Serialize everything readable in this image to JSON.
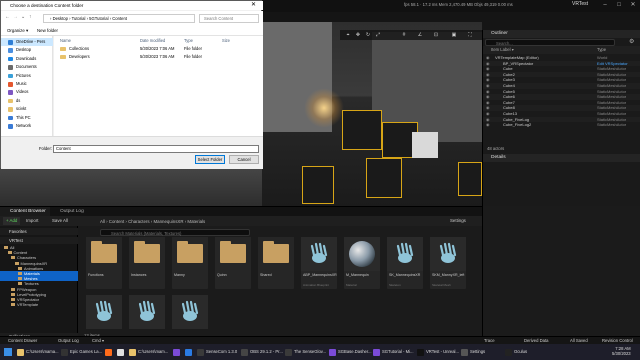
{
  "app": {
    "title": "VRTest"
  },
  "stats": "fps 58.1  · 17.2 ms  Mem 2,470.49 MB  Objs 49,319  0.00 ms",
  "dialog": {
    "title": "Choose a destination Content folder",
    "breadcrumb": [
      "Desktop",
      "Tutorial",
      "5GTutorial",
      "Content"
    ],
    "search_placeholder": "Search Content",
    "organize": "Organize ▾",
    "new_folder": "New folder",
    "nav": [
      {
        "label": "OneDrive - Pers",
        "color": "#2f7fd6",
        "selected": true
      },
      {
        "label": "Desktop",
        "color": "#4a8fe0"
      },
      {
        "label": "Downloads",
        "color": "#1e88e5"
      },
      {
        "label": "Documents",
        "color": "#6b6b6b"
      },
      {
        "label": "Pictures",
        "color": "#3aa0d8"
      },
      {
        "label": "Music",
        "color": "#e4572e"
      },
      {
        "label": "Videos",
        "color": "#7e57c2"
      },
      {
        "label": "ds",
        "color": "#e8c26b"
      },
      {
        "label": "scivkt",
        "color": "#e8c26b"
      },
      {
        "label": "This PC",
        "color": "#3a7bd5"
      },
      {
        "label": "Network",
        "color": "#3a7bd5"
      }
    ],
    "columns": [
      "Name",
      "Date modified",
      "Type",
      "Size"
    ],
    "files": [
      {
        "name": "Collections",
        "date": "5/30/2023 7:06 AM",
        "type": "File folder"
      },
      {
        "name": "Developers",
        "date": "5/30/2023 7:06 AM",
        "type": "File folder"
      }
    ],
    "folder_label": "Folder:",
    "folder_value": "Content",
    "select_button": "Select Folder",
    "cancel_button": "Cancel"
  },
  "outliner": {
    "tab": "Outliner",
    "search_placeholder": "Search...",
    "col_label": "Item Label ▾",
    "col_type": "Type",
    "rows": [
      {
        "name": "VRTemplateMap (Editor)",
        "type": "World"
      },
      {
        "name": "BP_VRSpectator",
        "type": "Edit VRSpectator"
      },
      {
        "name": "Cube",
        "type": "StaticMeshActor"
      },
      {
        "name": "Cube2",
        "type": "StaticMeshActor"
      },
      {
        "name": "Cube3",
        "type": "StaticMeshActor"
      },
      {
        "name": "Cube4",
        "type": "StaticMeshActor"
      },
      {
        "name": "Cube5",
        "type": "StaticMeshActor"
      },
      {
        "name": "Cube6",
        "type": "StaticMeshActor"
      },
      {
        "name": "Cube7",
        "type": "StaticMeshActor"
      },
      {
        "name": "Cube8",
        "type": "StaticMeshActor"
      },
      {
        "name": "Cube13",
        "type": "StaticMeshActor"
      },
      {
        "name": "Cube_FiveLog",
        "type": "StaticMeshActor"
      },
      {
        "name": "Cube_FiveLog2",
        "type": "StaticMeshActor"
      }
    ],
    "actors_count": "48 actors"
  },
  "details": {
    "tab": "Details"
  },
  "content_browser": {
    "tab": "Content Browser",
    "output_tab": "Output Log",
    "add": "+ Add",
    "import": "Import",
    "save_all": "Save All",
    "settings": "Settings",
    "path": [
      "All",
      "Content",
      "Characters",
      "MannequinsXR",
      "Materials"
    ],
    "search_placeholder": "Search Materials (Materials, Textures)",
    "favorites": "Favorites",
    "project": "VRTest",
    "collections": "Collections",
    "tree": [
      {
        "label": "All",
        "indent": 0
      },
      {
        "label": "Content",
        "indent": 1
      },
      {
        "label": "Characters",
        "indent": 2
      },
      {
        "label": "MannequinsXR",
        "indent": 3
      },
      {
        "label": "Animations",
        "indent": 4
      },
      {
        "label": "Materials",
        "indent": 4,
        "selected": true
      },
      {
        "label": "Meshes",
        "indent": 4,
        "selected": true
      },
      {
        "label": "Textures",
        "indent": 4
      },
      {
        "label": "FPWeapon",
        "indent": 2
      },
      {
        "label": "LevelPrototyping",
        "indent": 2
      },
      {
        "label": "VRSpectator",
        "indent": 2
      },
      {
        "label": "VRTemplate",
        "indent": 2
      }
    ],
    "assets": [
      {
        "label": "Functions",
        "kind": "folder"
      },
      {
        "label": "Instances",
        "kind": "folder"
      },
      {
        "label": "Manny",
        "kind": "folder"
      },
      {
        "label": "Quinn",
        "kind": "folder"
      },
      {
        "label": "Shared",
        "kind": "folder"
      },
      {
        "label": "ABP_MannequinsXR",
        "kind": "hand",
        "sub": "Animation Blueprint"
      },
      {
        "label": "M_Mannequin",
        "kind": "sphere",
        "sub": "Material"
      },
      {
        "label": "SK_MannequinsXR",
        "kind": "hand",
        "sub": "Skeleton"
      },
      {
        "label": "SKM_MannyXR_left",
        "kind": "hand",
        "sub": "Skeletal Mesh"
      },
      {
        "label": "",
        "kind": "hand"
      },
      {
        "label": "",
        "kind": "hand"
      },
      {
        "label": "",
        "kind": "hand"
      }
    ],
    "items_count": "13 items"
  },
  "statusbar": {
    "drawer": "Content Drawer",
    "output": "Output Log",
    "cmd": "Cmd ▾",
    "trace": "Trace",
    "derived": "Derived Data",
    "saved": "All Saved",
    "revision": "Revision Control"
  },
  "taskbar": [
    {
      "label": "C:\\Users\\mama...",
      "color": "#e8c26b"
    },
    {
      "label": "Epic Games La...",
      "color": "#333333"
    },
    {
      "label": "",
      "color": "#ff6b1a"
    },
    {
      "label": "",
      "color": "#e0e0e0"
    },
    {
      "label": "C:\\Users\\mam...",
      "color": "#e8c26b"
    },
    {
      "label": "",
      "color": "#7b4bd8"
    },
    {
      "label": "",
      "color": "#2a7be4"
    },
    {
      "label": "SenseCom 1.3.0",
      "color": "#3a3a3a"
    },
    {
      "label": "OBS 29.1.2 - Pr...",
      "color": "#444444"
    },
    {
      "label": "The SenseGlov...",
      "color": "#3a3a3a"
    },
    {
      "label": "SGBase.Dasher...",
      "color": "#7b4bd8"
    },
    {
      "label": "SGTutorial - Mi...",
      "color": "#7b4bd8"
    },
    {
      "label": "VRTest - Unreal...",
      "color": "#111111"
    },
    {
      "label": "Settings",
      "color": "#555555"
    },
    {
      "label": "Oculus",
      "color": "#222222"
    }
  ],
  "clock": {
    "time": "7:28 AM",
    "date": "5/30/2023"
  }
}
